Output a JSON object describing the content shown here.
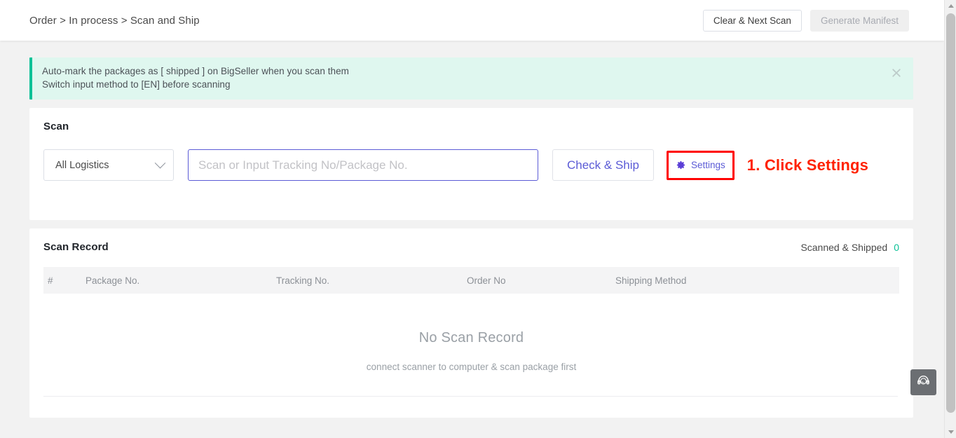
{
  "header": {
    "breadcrumb": "Order > In process > Scan and Ship",
    "clear_next_scan_label": "Clear & Next Scan",
    "generate_manifest_label": "Generate Manifest"
  },
  "notice": {
    "line1": "Auto-mark the packages as [ shipped ] on BigSeller when you scan them",
    "line2": "Switch input method to [EN] before scanning",
    "close_icon": "close-icon",
    "accent_color": "#0bc197",
    "background_color": "#dff7ef"
  },
  "scan": {
    "title": "Scan",
    "logistics_selected": "All Logistics",
    "chevron_icon": "chevron-down-icon",
    "input_value": "",
    "input_placeholder": "Scan or Input Tracking No/Package No.",
    "check_ship_label": "Check & Ship",
    "settings_label": "Settings",
    "settings_icon": "gear-icon",
    "accent_color": "#5b5bd6"
  },
  "annotation": {
    "text": "1. Click Settings",
    "color": "#ff2200",
    "highlight_color": "#ff0000"
  },
  "record": {
    "title": "Scan Record",
    "scanned_shipped_label": "Scanned & Shipped",
    "scanned_shipped_count": "0",
    "count_color": "#0bc197",
    "columns": [
      "#",
      "Package No.",
      "Tracking No.",
      "Order No",
      "Shipping Method"
    ],
    "rows": [],
    "empty_title": "No Scan Record",
    "empty_subtitle": "connect scanner to computer & scan package first"
  },
  "support": {
    "icon": "headset-icon"
  },
  "scrollbar": {
    "up_icon": "scroll-up-arrow-icon",
    "down_icon": "scroll-down-arrow-icon"
  }
}
